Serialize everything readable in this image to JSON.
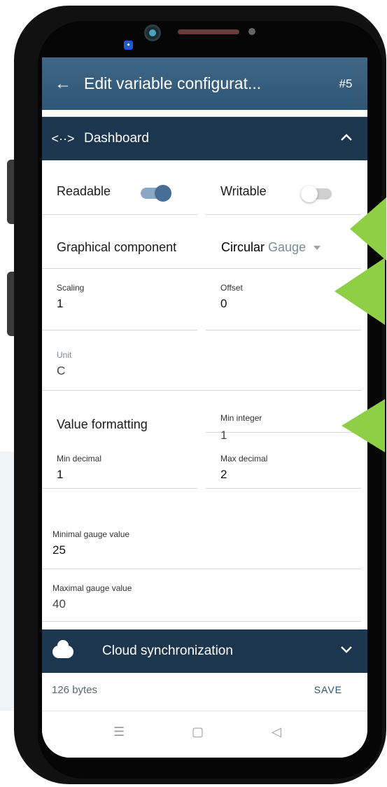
{
  "appbar": {
    "title": "Edit variable configurat...",
    "number": "#5"
  },
  "dashboard": {
    "icon": "<··>",
    "label": "Dashboard"
  },
  "fields": {
    "readable_label": "Readable",
    "readable_on": true,
    "writable_label": "Writable",
    "writable_on": false,
    "graphical_label": "Graphical component",
    "graphical_value_1": "Circular",
    "graphical_value_2": "Gauge",
    "scaling_label": "Scaling",
    "scaling_value": "1",
    "offset_label": "Offset",
    "offset_value": "0",
    "unit_label": "Unit",
    "unit_value": "C",
    "value_formatting_label": "Value formatting",
    "min_integer_label": "Min integer",
    "min_integer_value": "1",
    "min_decimal_label": "Min decimal",
    "min_decimal_value": "1",
    "max_decimal_label": "Max decimal",
    "max_decimal_value": "2",
    "min_gauge_label": "Minimal gauge value",
    "min_gauge_value": "25",
    "max_gauge_label": "Maximal gauge value",
    "max_gauge_value": "40"
  },
  "cloud": {
    "label": "Cloud synchronization"
  },
  "footer": {
    "bytes": "126 bytes",
    "save": "SAVE"
  },
  "navbar": {
    "menu_icon": "☰",
    "home_icon": "▢",
    "back_icon": "◁"
  },
  "colors": {
    "appbar": "#34597a",
    "section_header": "#1c3650",
    "accent": "#476f95",
    "arrow": "#8fcf45"
  }
}
